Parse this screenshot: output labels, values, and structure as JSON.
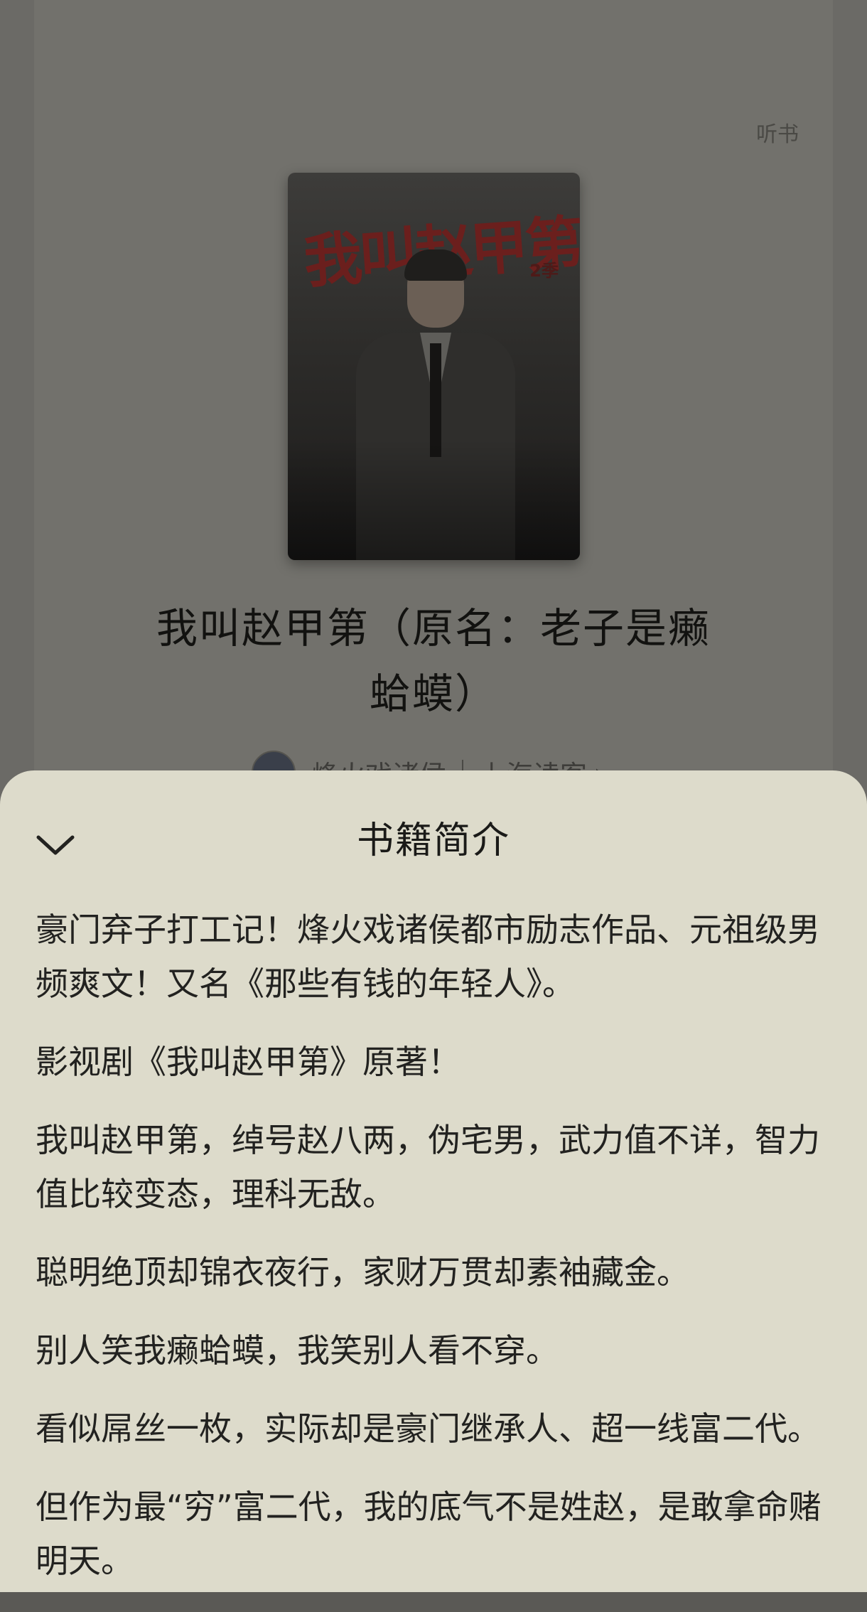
{
  "header": {
    "listen_label": "听书"
  },
  "book": {
    "title_line1": "我叫赵甲第（原名：老子是癞",
    "title_line2": "蛤蟆）",
    "author": "烽火戏诸侯",
    "publisher": "上海读客",
    "cover_title": "我叫赵甲第",
    "cover_series": "2季"
  },
  "sheet": {
    "title": "书籍简介",
    "paragraphs": [
      "豪门弃子打工记！烽火戏诸侯都市励志作品、元祖级男频爽文！又名《那些有钱的年轻人》。",
      "影视剧《我叫赵甲第》原著！",
      "我叫赵甲第，绰号赵八两，伪宅男，武力值不详，智力值比较变态，理科无敌。",
      "聪明绝顶却锦衣夜行，家财万贯却素袖藏金。",
      "别人笑我癞蛤蟆，我笑别人看不穿。",
      "看似屌丝一枚，实际却是豪门继承人、超一线富二代。",
      "但作为最“穷”富二代，我的底气不是姓赵，是敢拿命赌明天。"
    ]
  },
  "colors": {
    "sheet_bg": "#dddbcb",
    "overlay_bg": "#6b6a66"
  },
  "icons": {
    "collapse": "chevron-down-icon",
    "author_link": "chevron-right-icon"
  }
}
